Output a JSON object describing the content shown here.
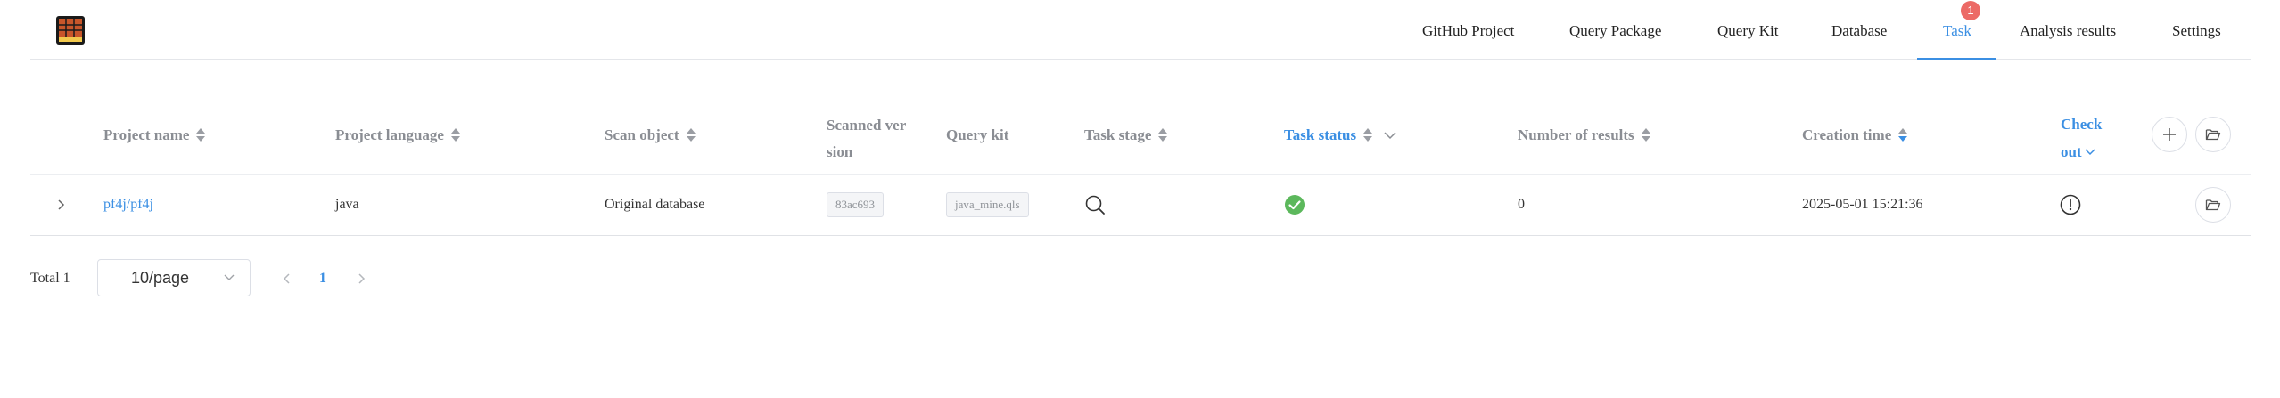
{
  "nav": {
    "items": [
      {
        "label": "GitHub Project"
      },
      {
        "label": "Query Package"
      },
      {
        "label": "Query Kit"
      },
      {
        "label": "Database"
      },
      {
        "label": "Task",
        "badge": "1",
        "active": true
      },
      {
        "label": "Analysis results"
      },
      {
        "label": "Settings"
      }
    ]
  },
  "table": {
    "columns": {
      "project_name": "Project name",
      "project_language": "Project language",
      "scan_object": "Scan object",
      "scanned_version_1": "Scanned ver",
      "scanned_version_2": "sion",
      "query_kit": "Query kit",
      "task_stage": "Task stage",
      "task_status": "Task status",
      "number_of_results": "Number of results",
      "creation_time": "Creation time",
      "check_out_1": "Check",
      "check_out_2": "out"
    },
    "rows": [
      {
        "project_name": "pf4j/pf4j",
        "project_language": "java",
        "scan_object": "Original database",
        "scanned_version": "83ac693",
        "query_kit": "java_mine.qls",
        "task_stage_icon": "search-icon",
        "task_status_icon": "success-check-icon",
        "number_of_results": "0",
        "creation_time": "2025-05-01 15:21:36",
        "check_out_icon": "alert-circle-icon"
      }
    ]
  },
  "pagination": {
    "total": "Total 1",
    "page_size": "10/page",
    "current_page": "1"
  },
  "colors": {
    "accent": "#3b8fe3",
    "badge": "#ec6a66",
    "success": "#5cb85c"
  }
}
